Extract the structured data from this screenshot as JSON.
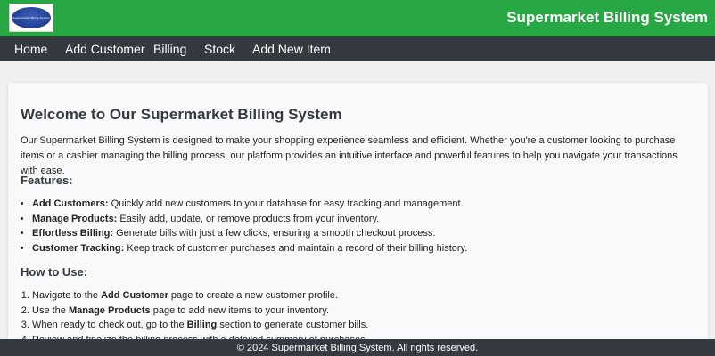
{
  "header": {
    "logo_text": "Supermarket Billing System",
    "title": "Supermarket Billing System"
  },
  "nav": {
    "items": [
      {
        "label": "Home"
      },
      {
        "label": "Add Customer"
      },
      {
        "label": "Billing"
      },
      {
        "label": "Stock"
      },
      {
        "label": "Add New Item"
      }
    ]
  },
  "main": {
    "heading": "Welcome to Our Supermarket Billing System",
    "intro": "Our Supermarket Billing System is designed to make your shopping experience seamless and efficient. Whether you're a customer looking to purchase items or a cashier managing the billing process, our platform provides an intuitive interface and powerful features to help you navigate your transactions with ease.",
    "features_title": "Features:",
    "features": [
      {
        "bold": "Add Customers:",
        "text": " Quickly add new customers to your database for easy tracking and management."
      },
      {
        "bold": "Manage Products:",
        "text": " Easily add, update, or remove products from your inventory."
      },
      {
        "bold": "Effortless Billing:",
        "text": " Generate bills with just a few clicks, ensuring a smooth checkout process."
      },
      {
        "bold": "Customer Tracking:",
        "text": " Keep track of customer purchases and maintain a record of their billing history."
      }
    ],
    "howto_title": "How to Use:",
    "steps": [
      {
        "pre": "Navigate to the ",
        "bold": "Add Customer",
        "post": " page to create a new customer profile."
      },
      {
        "pre": "Use the ",
        "bold": "Manage Products",
        "post": " page to add new items to your inventory."
      },
      {
        "pre": "When ready to check out, go to the ",
        "bold": "Billing",
        "post": " section to generate customer bills."
      },
      {
        "pre": "Review and finalize the billing process with a detailed summary of purchases.",
        "bold": "",
        "post": ""
      }
    ]
  },
  "footer": {
    "text": "© 2024 Supermarket Billing System. All rights reserved."
  },
  "colors": {
    "header_bg": "#28a745",
    "nav_bg": "#343a40",
    "footer_bg": "#343a40"
  }
}
